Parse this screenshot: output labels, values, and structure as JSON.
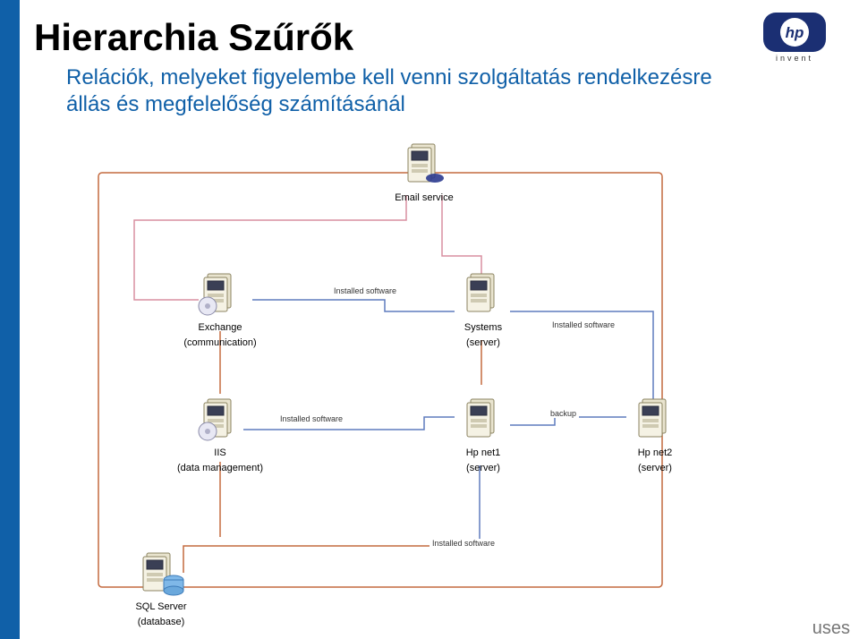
{
  "title": "Hierarchia Szűrők",
  "subtitle": "Relációk, melyeket figyelembe kell venni szolgáltatás rendelkezésre állás és megfelelőség számításánál",
  "logo": {
    "letters": "hp",
    "subtext": "invent"
  },
  "nodes": {
    "email": {
      "line1": "Email service"
    },
    "exchange": {
      "line1": "Exchange",
      "line2": "(communication)"
    },
    "systems": {
      "line1": "Systems",
      "line2": "(server)"
    },
    "iis": {
      "line1": "IIS",
      "line2": "(data management)"
    },
    "hpnet1": {
      "line1": "Hp net1",
      "line2": "(server)"
    },
    "hpnet2": {
      "line1": "Hp net2",
      "line2": "(server)"
    },
    "sql": {
      "line1": "SQL Server",
      "line2": "(database)"
    }
  },
  "edge_labels": {
    "e1": "Installed software",
    "e2": "Installed software",
    "e3": "Installed software",
    "e4": "backup",
    "e5": "Installed software"
  },
  "bottom_word": "uses"
}
